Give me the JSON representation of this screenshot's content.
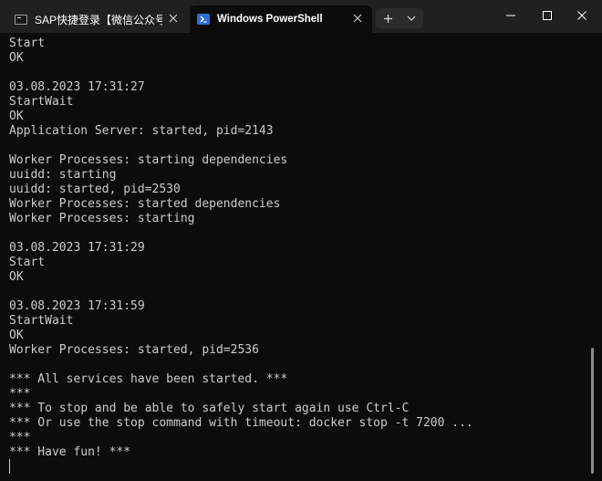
{
  "tabs": [
    {
      "title": "SAP快捷登录【微信公众号:ABA",
      "icon": "terminal-icon",
      "active": false
    },
    {
      "title": "Windows PowerShell",
      "icon": "powershell-icon",
      "active": true
    }
  ],
  "toolbar": {
    "new_tab_icon": "plus-icon",
    "dropdown_icon": "chevron-down-icon"
  },
  "window_controls": [
    "minimize-icon",
    "maximize-icon",
    "close-icon"
  ],
  "terminal": {
    "lines": [
      "Start",
      "OK",
      "",
      "03.08.2023 17:31:27",
      "StartWait",
      "OK",
      "Application Server: started, pid=2143",
      "",
      "Worker Processes: starting dependencies",
      "uuidd: starting",
      "uuidd: started, pid=2530",
      "Worker Processes: started dependencies",
      "Worker Processes: starting",
      "",
      "03.08.2023 17:31:29",
      "Start",
      "OK",
      "",
      "03.08.2023 17:31:59",
      "StartWait",
      "OK",
      "Worker Processes: started, pid=2536",
      "",
      "*** All services have been started. ***",
      "***",
      "*** To stop and be able to safely start again use Ctrl-C",
      "*** Or use the stop command with timeout: docker stop -t 7200 ...",
      "***",
      "*** Have fun! ***"
    ]
  },
  "colors": {
    "titlebar": "#202020",
    "terminal_bg": "#0c0c0c",
    "text": "#cccccc",
    "powershell_accent": "#2f6fd6"
  }
}
